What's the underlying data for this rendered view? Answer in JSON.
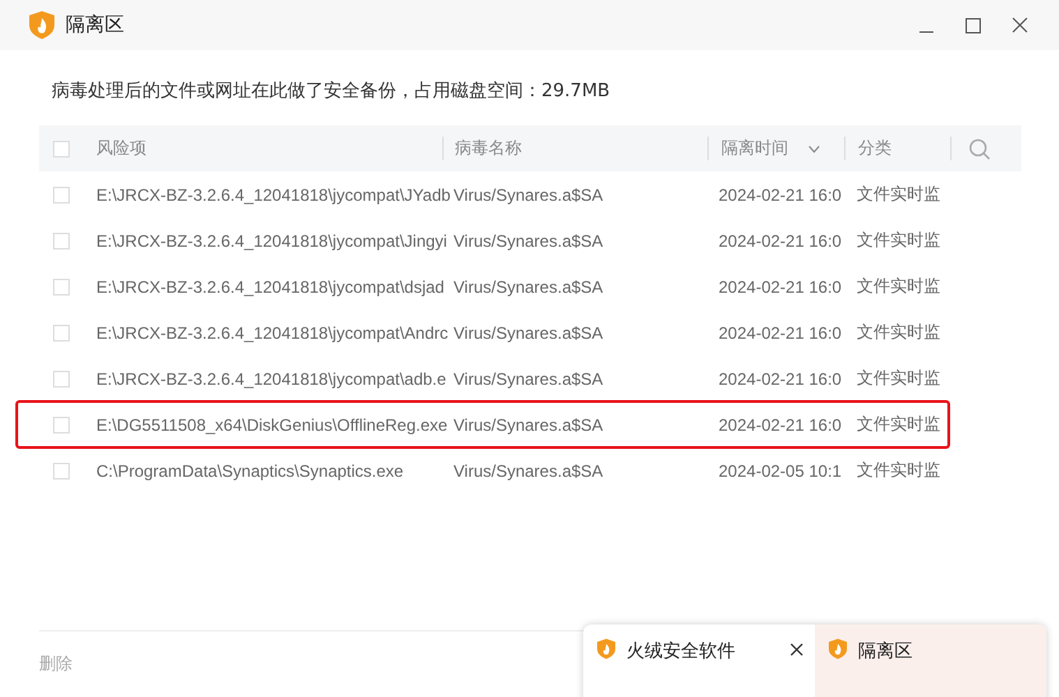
{
  "window": {
    "title": "隔离区"
  },
  "summary": "病毒处理后的文件或网址在此做了安全备份，占用磁盘空间：29.7MB",
  "table": {
    "select_all": {
      "checked": false
    },
    "columns": [
      {
        "label": "风险项",
        "sortable": false
      },
      {
        "label": "病毒名称",
        "sortable": false
      },
      {
        "label": "隔离时间",
        "sortable": true
      },
      {
        "label": "分类",
        "sortable": false
      }
    ],
    "rows": [
      {
        "checked": false,
        "highlighted": false,
        "cells": [
          "E:\\JRCX-BZ-3.2.6.4_12041818\\jycompat\\JYadb",
          "Virus/Synares.a$SA",
          "2024-02-21 16:0",
          "文件实时监"
        ]
      },
      {
        "checked": false,
        "highlighted": false,
        "cells": [
          "E:\\JRCX-BZ-3.2.6.4_12041818\\jycompat\\Jingyi",
          "Virus/Synares.a$SA",
          "2024-02-21 16:0",
          "文件实时监"
        ]
      },
      {
        "checked": false,
        "highlighted": false,
        "cells": [
          "E:\\JRCX-BZ-3.2.6.4_12041818\\jycompat\\dsjad",
          "Virus/Synares.a$SA",
          "2024-02-21 16:0",
          "文件实时监"
        ]
      },
      {
        "checked": false,
        "highlighted": false,
        "cells": [
          "E:\\JRCX-BZ-3.2.6.4_12041818\\jycompat\\Andrc",
          "Virus/Synares.a$SA",
          "2024-02-21 16:0",
          "文件实时监"
        ]
      },
      {
        "checked": false,
        "highlighted": false,
        "cells": [
          "E:\\JRCX-BZ-3.2.6.4_12041818\\jycompat\\adb.e",
          "Virus/Synares.a$SA",
          "2024-02-21 16:0",
          "文件实时监"
        ]
      },
      {
        "checked": false,
        "highlighted": true,
        "cells": [
          "E:\\DG5511508_x64\\DiskGenius\\OfflineReg.exe",
          "Virus/Synares.a$SA",
          "2024-02-21 16:0",
          "文件实时监"
        ]
      },
      {
        "checked": false,
        "highlighted": false,
        "cells": [
          "C:\\ProgramData\\Synaptics\\Synaptics.exe",
          "Virus/Synares.a$SA",
          "2024-02-05 10:1",
          "文件实时监"
        ]
      }
    ]
  },
  "footer": {
    "delete_button": {
      "label": "删除",
      "disabled": true
    }
  },
  "taskbar_preview": {
    "items": [
      {
        "title": "火绒安全软件",
        "selected": false,
        "closable": true
      },
      {
        "title": "隔离区",
        "selected": true,
        "closable": false
      }
    ]
  }
}
